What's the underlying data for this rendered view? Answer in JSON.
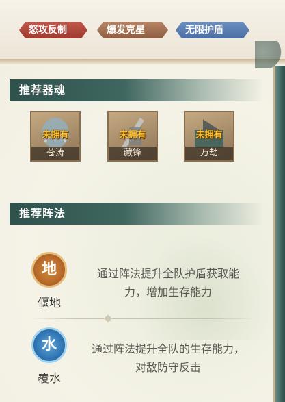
{
  "tags": [
    {
      "label": "怒攻反制",
      "color": "#b04a3e"
    },
    {
      "label": "爆发克星",
      "color": "#a06f51"
    },
    {
      "label": "无限护盾",
      "color": "#5b7fb3"
    }
  ],
  "souls_section": {
    "title": "推荐器魂",
    "items": [
      {
        "name": "苍涛",
        "status": "未拥有"
      },
      {
        "name": "藏锋",
        "status": "未拥有"
      },
      {
        "name": "万劫",
        "status": "未拥有"
      }
    ]
  },
  "formation_section": {
    "title": "推荐阵法",
    "items": [
      {
        "name": "偃地",
        "icon": "earth-emblem-icon",
        "glyph": "地",
        "description": "通过阵法提升全队护盾获取能力，增加生存能力"
      },
      {
        "name": "覆水",
        "icon": "water-emblem-icon",
        "glyph": "水",
        "description": "通过阵法提升全队的生存能力，对敌防守反击"
      }
    ]
  },
  "colors": {
    "header_teal": "#2f514c",
    "unowned_yellow": "#f7c02c"
  }
}
